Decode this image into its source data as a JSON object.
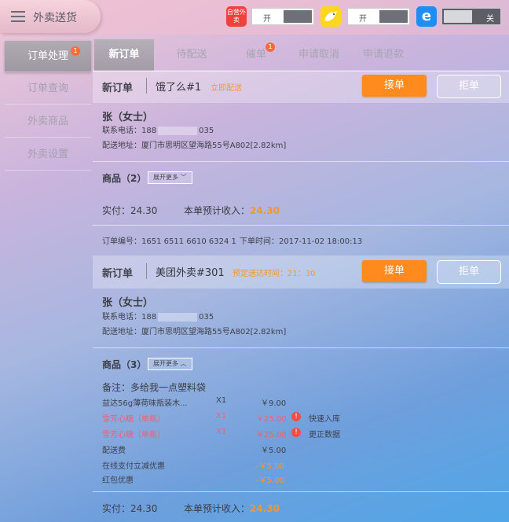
{
  "app": {
    "title": "外卖送货"
  },
  "topbar": {
    "platforms": [
      {
        "badge": "自营外卖",
        "state": "开"
      },
      {
        "badge": "",
        "state": "开"
      },
      {
        "badge": "e",
        "state": "关"
      }
    ]
  },
  "sidebar": {
    "items": [
      {
        "label": "订单处理",
        "badge": "1"
      },
      {
        "label": "订单查询"
      },
      {
        "label": "外卖商品"
      },
      {
        "label": "外卖设置"
      }
    ]
  },
  "tabs": [
    {
      "label": "新订单"
    },
    {
      "label": "待配送"
    },
    {
      "label": "催单",
      "badge": "1"
    },
    {
      "label": "申请取消"
    },
    {
      "label": "申请退款"
    }
  ],
  "orders": [
    {
      "tag": "新订单",
      "source": "饿了么#1",
      "note": "立即配送",
      "accept": "接单",
      "reject": "拒单",
      "customer": "张（女士）",
      "phone_label": "联系电话：",
      "phone_a": "188",
      "phone_b": "035",
      "address": "配送地址：厦门市思明区望海路55号A802[2.82km]",
      "goods_label": "商品（2）",
      "expand": "展开更多",
      "paid_label": "实付：",
      "paid": "24.30",
      "income_label": "本单预计收入：",
      "income": "24.30",
      "order_no_label": "订单编号：",
      "order_no": "1651 6511 6610 6324 1",
      "time_label": "下单时间：",
      "time": "2017-11-02 18:00:13"
    },
    {
      "tag": "新订单",
      "source": "美团外卖#301",
      "note": "预定送达时间：21：30",
      "accept": "接单",
      "reject": "拒单",
      "customer": "张（女士）",
      "phone_label": "联系电话：",
      "phone_a": "188",
      "phone_b": "035",
      "address": "配送地址：厦门市思明区望海路55号A802[2.82km]",
      "goods_label": "商品（3）",
      "expand": "展开更多",
      "remark": "备注：多给我一点塑料袋",
      "items": [
        {
          "name": "益达56g薄荷味瓶装木...",
          "qty": "X1",
          "price": "￥9.00",
          "action": ""
        },
        {
          "name": "雪芳心糖（单瓶）",
          "qty": "X1",
          "price": "￥25.00",
          "action": "快速入库"
        },
        {
          "name": "雪芳心糖（单瓶）",
          "qty": "X1",
          "price": "￥25.00",
          "action": "更正数据"
        }
      ],
      "fees": [
        {
          "name": "配送费",
          "price": "￥5.00"
        },
        {
          "name": "在线支付立减优惠",
          "price": "-￥5.00"
        },
        {
          "name": "红包优惠",
          "price": "-￥5.00"
        }
      ],
      "paid_label": "实付：",
      "paid": "24.30",
      "income_label": "本单预计收入：",
      "income": "24.30"
    }
  ]
}
